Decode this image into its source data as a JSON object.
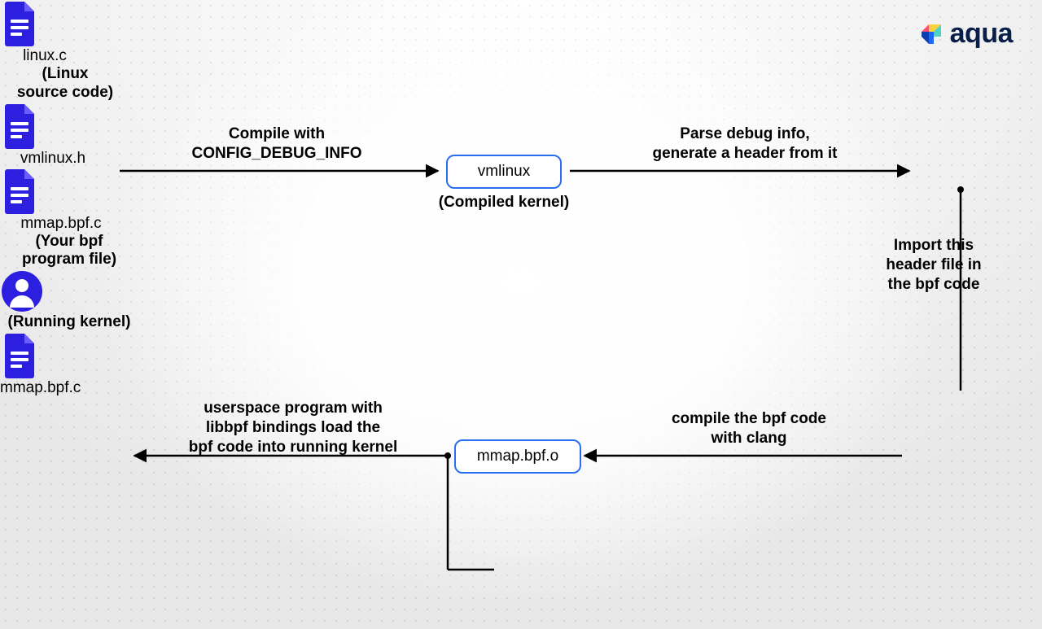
{
  "logo": {
    "text": "aqua"
  },
  "nodes": {
    "linuxc": {
      "label": "linux.c",
      "sub": "(Linux\nsource code)"
    },
    "vmlinux": {
      "label": "vmlinux",
      "sub": "(Compiled kernel)"
    },
    "vmlinuxh": {
      "label": "vmlinux.h"
    },
    "mmapbpfc": {
      "label": "mmap.bpf.c",
      "sub": "(Your bpf\nprogram file)"
    },
    "mmapbpfo": {
      "label": "mmap.bpf.o"
    },
    "mmapbpfc2": {
      "label": "mmap.bpf.c"
    },
    "kernel": {
      "sub": "(Running kernel)"
    }
  },
  "edges": {
    "compile": "Compile with\nCONFIG_DEBUG_INFO",
    "parse": "Parse debug info,\ngenerate a header from it",
    "import": "Import this\nheader file in\nthe bpf code",
    "clang": "compile the bpf code\nwith clang",
    "load": "userspace program with\nlibbpf bindings load the\nbpf code into running kernel"
  }
}
